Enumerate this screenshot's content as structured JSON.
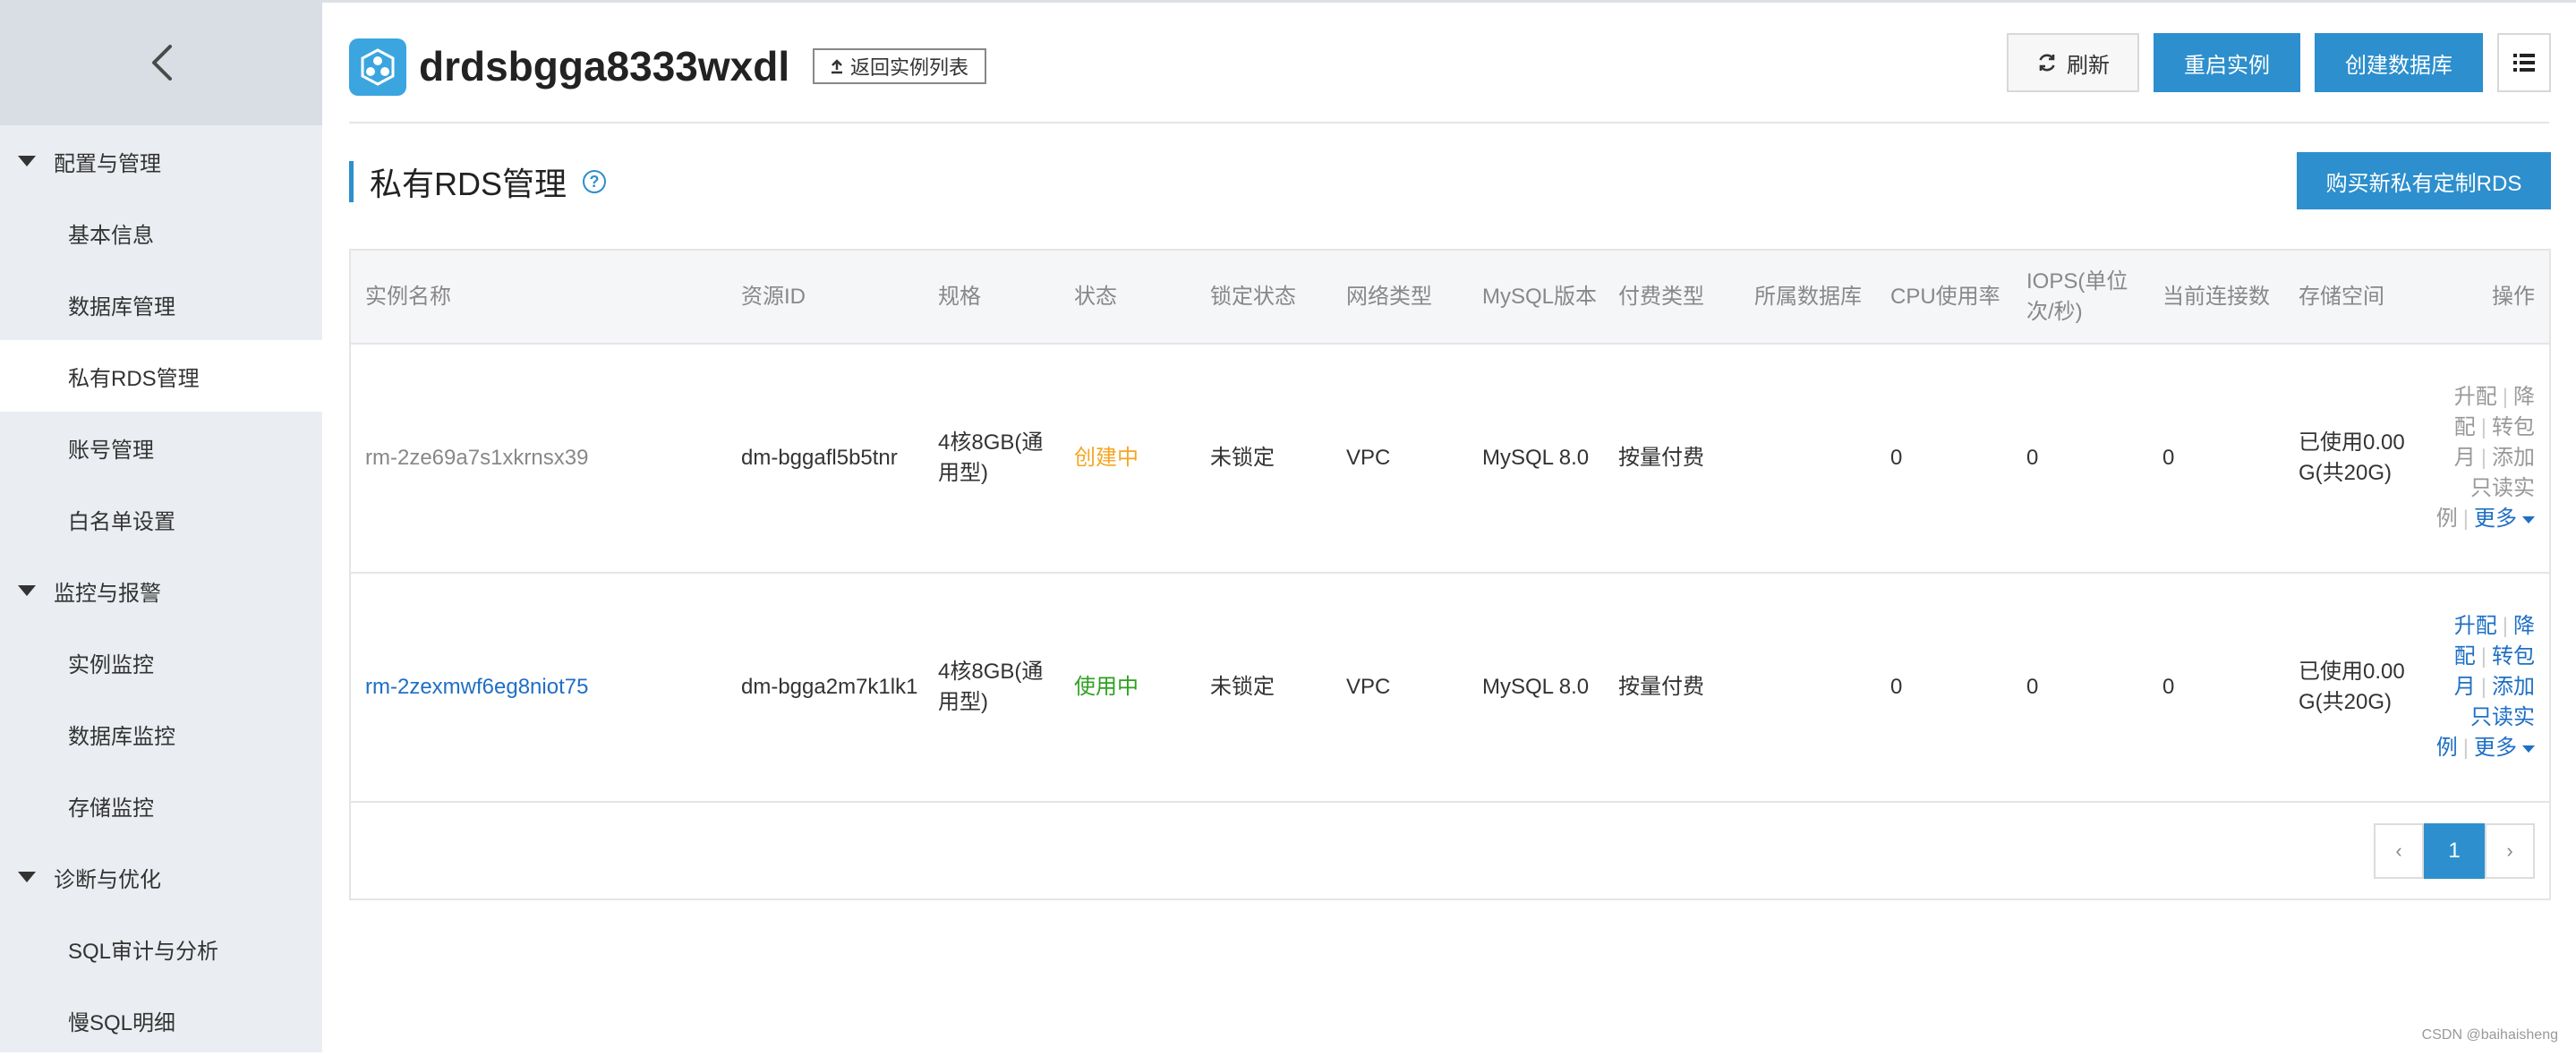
{
  "sidebar": {
    "groups": [
      {
        "label": "配置与管理",
        "items": [
          {
            "label": "基本信息"
          },
          {
            "label": "数据库管理"
          },
          {
            "label": "私有RDS管理",
            "active": true
          },
          {
            "label": "账号管理"
          },
          {
            "label": "白名单设置"
          }
        ]
      },
      {
        "label": "监控与报警",
        "items": [
          {
            "label": "实例监控"
          },
          {
            "label": "数据库监控"
          },
          {
            "label": "存储监控"
          }
        ]
      },
      {
        "label": "诊断与优化",
        "items": [
          {
            "label": "SQL审计与分析"
          },
          {
            "label": "慢SQL明细"
          }
        ]
      }
    ]
  },
  "header": {
    "instance_name": "drdsbgga8333wxdl",
    "back_label": "返回实例列表",
    "refresh_label": "刷新",
    "restart_label": "重启实例",
    "create_db_label": "创建数据库"
  },
  "section": {
    "title": "私有RDS管理",
    "help_glyph": "?",
    "buy_label": "购买新私有定制RDS"
  },
  "table": {
    "columns": [
      "实例名称",
      "资源ID",
      "规格",
      "状态",
      "锁定状态",
      "网络类型",
      "MySQL版本",
      "付费类型",
      "所属数据库",
      "CPU使用率",
      "IOPS(单位次/秒)",
      "当前连接数",
      "存储空间",
      "操作"
    ],
    "rows": [
      {
        "name": "rm-2ze69a7s1xkrnsx39",
        "resource_id": "dm-bggafl5b5tnr",
        "spec": "4核8GB(通用型)",
        "status": "创建中",
        "lock": "未锁定",
        "network": "VPC",
        "version": "MySQL 8.0",
        "pay": "按量付费",
        "db": "",
        "cpu": "0",
        "iops": "0",
        "conn": "0",
        "storage": "已使用0.00G(共20G)",
        "ops": {
          "upgrade": "升配",
          "downgrade": "降配",
          "monthly": "转包月",
          "readonly": "添加只读实例",
          "more": "更多"
        }
      },
      {
        "name": "rm-2zexmwf6eg8niot75",
        "resource_id": "dm-bgga2m7k1lk1",
        "spec": "4核8GB(通用型)",
        "status": "使用中",
        "lock": "未锁定",
        "network": "VPC",
        "version": "MySQL 8.0",
        "pay": "按量付费",
        "db": "",
        "cpu": "0",
        "iops": "0",
        "conn": "0",
        "storage": "已使用0.00G(共20G)",
        "ops": {
          "upgrade": "升配",
          "downgrade": "降配",
          "monthly": "转包月",
          "readonly": "添加只读实例",
          "more": "更多"
        }
      }
    ]
  },
  "pagination": {
    "prev": "‹",
    "current": "1",
    "next": "›"
  },
  "watermark": "CSDN @baihaisheng",
  "colors": {
    "primary": "#2d8fcd",
    "link": "#1f6fc5",
    "creating": "#f5a623",
    "running": "#2ea121",
    "sidebar_bg": "#eaedf1"
  }
}
